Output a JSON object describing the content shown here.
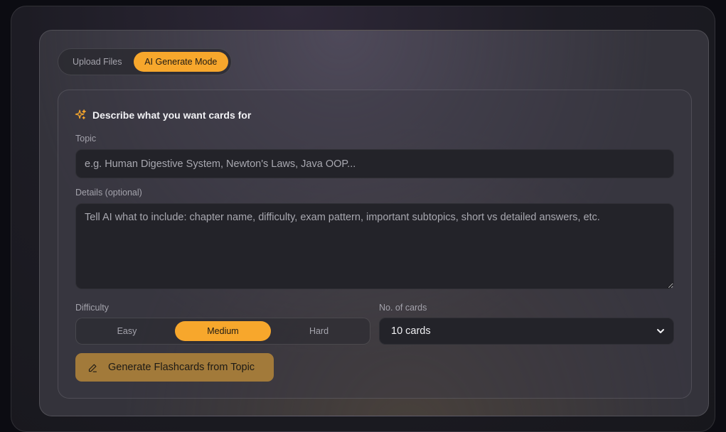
{
  "mode_toggle": {
    "upload_label": "Upload Files",
    "ai_label": "AI Generate Mode",
    "active": "ai"
  },
  "card": {
    "title": "Describe what you want cards for",
    "title_icon": "sparkle-icon"
  },
  "topic": {
    "label": "Topic",
    "value": "",
    "placeholder": "e.g. Human Digestive System, Newton's Laws, Java OOP..."
  },
  "details": {
    "label": "Details (optional)",
    "value": "",
    "placeholder": "Tell AI what to include: chapter name, difficulty, exam pattern, important subtopics, short vs detailed answers, etc."
  },
  "difficulty": {
    "label": "Difficulty",
    "options": [
      "Easy",
      "Medium",
      "Hard"
    ],
    "selected": "Medium"
  },
  "num_cards": {
    "label": "No. of cards",
    "selected": "10 cards"
  },
  "generate_button": {
    "label": "Generate Flashcards from Topic",
    "icon": "pencil-icon"
  },
  "colors": {
    "accent": "#f7a72c",
    "button_bg": "#a27a3a",
    "input_bg": "#232329"
  }
}
